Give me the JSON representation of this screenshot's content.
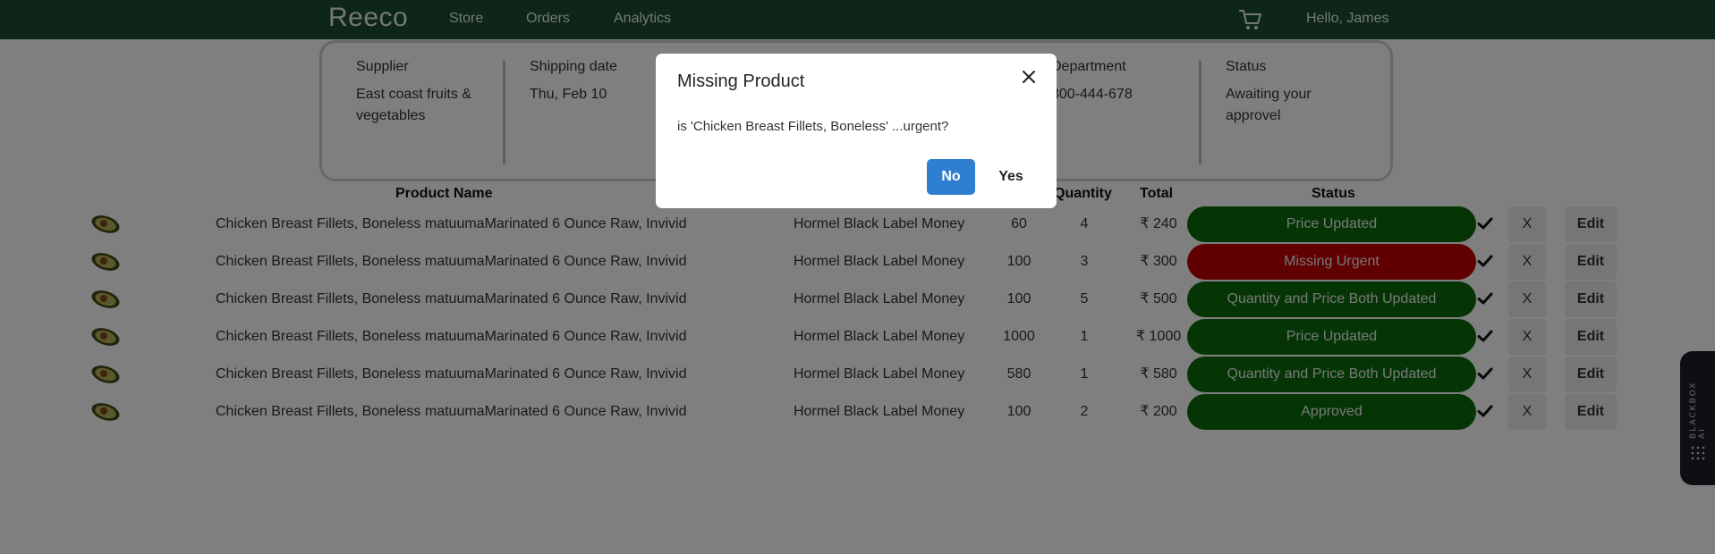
{
  "nav": {
    "brand": "Reeco",
    "links": [
      "Store",
      "Orders",
      "Analytics"
    ],
    "greeting": "Hello, James",
    "cart_icon": "cart-icon"
  },
  "info": {
    "supplier_label": "Supplier",
    "supplier_value_1": "East coast fruits &",
    "supplier_value_2": "vegetables",
    "shipping_label": "Shipping date",
    "shipping_value": "Thu, Feb 10",
    "department_label": "Department",
    "department_value": "300-444-678",
    "status_label": "Status",
    "status_value_1": "Awaiting your",
    "status_value_2": "approvel"
  },
  "table": {
    "headers": {
      "product_name": "Product Name",
      "quantity": "Quantity",
      "total": "Total",
      "status": "Status"
    },
    "rows": [
      {
        "name": "Chicken Breast Fillets, Boneless matuumaMarinated 6 Ounce Raw, Invivid",
        "brand": "Hormel Black Label Money",
        "price": "60",
        "quantity": "4",
        "total": "₹ 240",
        "status": "Price Updated",
        "status_color": "#0a6b0a",
        "x": "X",
        "edit": "Edit"
      },
      {
        "name": "Chicken Breast Fillets, Boneless matuumaMarinated 6 Ounce Raw, Invivid",
        "brand": "Hormel Black Label Money",
        "price": "100",
        "quantity": "3",
        "total": "₹ 300",
        "status": "Missing Urgent",
        "status_color": "#c00000",
        "x": "X",
        "edit": "Edit"
      },
      {
        "name": "Chicken Breast Fillets, Boneless matuumaMarinated 6 Ounce Raw, Invivid",
        "brand": "Hormel Black Label Money",
        "price": "100",
        "quantity": "5",
        "total": "₹ 500",
        "status": "Quantity and Price Both Updated",
        "status_color": "#0a6b0a",
        "x": "X",
        "edit": "Edit"
      },
      {
        "name": "Chicken Breast Fillets, Boneless matuumaMarinated 6 Ounce Raw, Invivid",
        "brand": "Hormel Black Label Money",
        "price": "1000",
        "quantity": "1",
        "total": "₹ 1000",
        "status": "Price Updated",
        "status_color": "#0a6b0a",
        "x": "X",
        "edit": "Edit"
      },
      {
        "name": "Chicken Breast Fillets, Boneless matuumaMarinated 6 Ounce Raw, Invivid",
        "brand": "Hormel Black Label Money",
        "price": "580",
        "quantity": "1",
        "total": "₹ 580",
        "status": "Quantity and Price Both Updated",
        "status_color": "#0a6b0a",
        "x": "X",
        "edit": "Edit"
      },
      {
        "name": "Chicken Breast Fillets, Boneless matuumaMarinated 6 Ounce Raw, Invivid",
        "brand": "Hormel Black Label Money",
        "price": "100",
        "quantity": "2",
        "total": "₹ 200",
        "status": "Approved",
        "status_color": "#0a6b0a",
        "x": "X",
        "edit": "Edit"
      }
    ]
  },
  "blackbox": {
    "label": "BLACKBOX AI"
  },
  "modal": {
    "title": "Missing Product",
    "message": "is 'Chicken Breast Fillets, Boneless' ...urgent?",
    "no_label": "No",
    "yes_label": "Yes"
  },
  "colors": {
    "navbar": "#1b4d2e",
    "primary_button": "#2f7fd1",
    "status_green": "#0a6b0a",
    "status_red": "#c00000"
  }
}
